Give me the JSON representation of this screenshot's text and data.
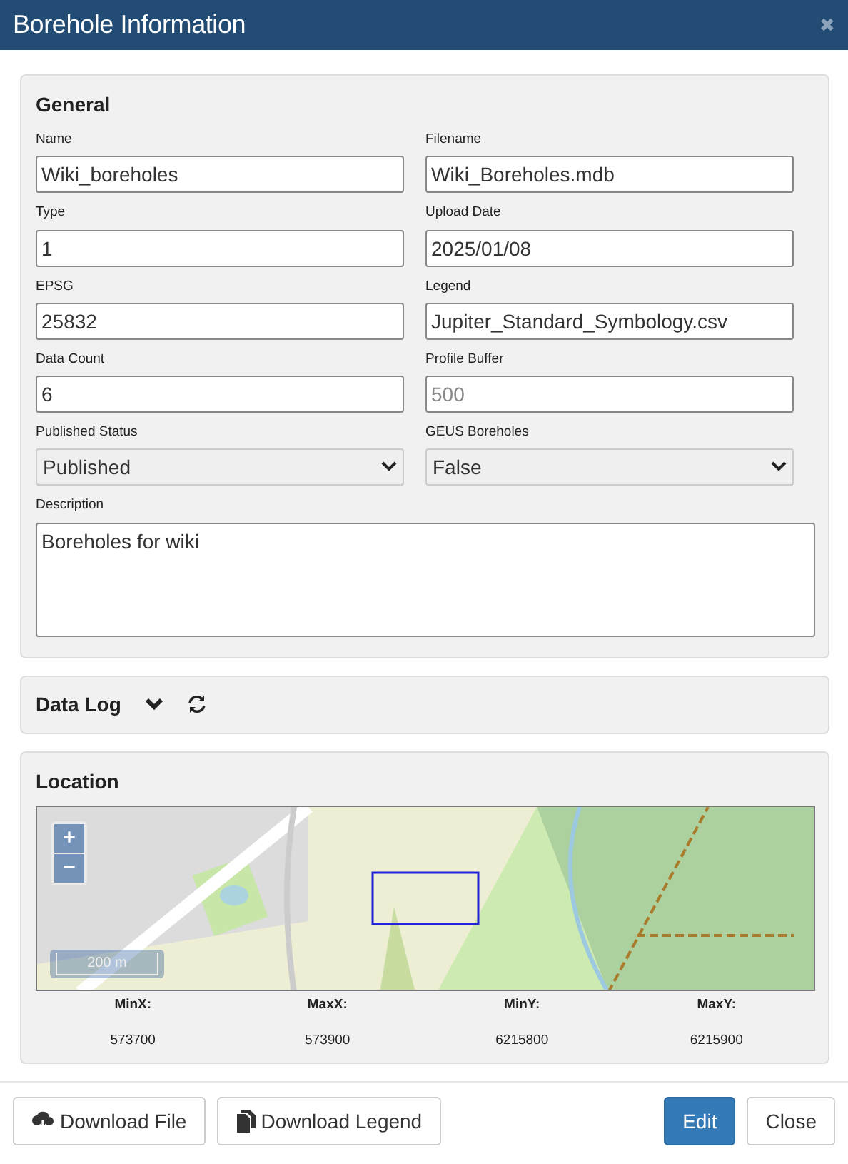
{
  "window": {
    "title": "Borehole Information",
    "close": "✖"
  },
  "general": {
    "title": "General",
    "fields": [
      {
        "label": "Name",
        "kind": "input",
        "value": "Wiki_boreholes"
      },
      {
        "label": "Filename",
        "kind": "input",
        "value": "Wiki_Boreholes.mdb"
      },
      {
        "label": "Type",
        "kind": "input",
        "value": "1"
      },
      {
        "label": "Upload Date",
        "kind": "input",
        "value": "2025/01/08"
      },
      {
        "label": "EPSG",
        "kind": "input",
        "value": "25832"
      },
      {
        "label": "Legend",
        "kind": "input",
        "value": "Jupiter_Standard_Symbology.csv"
      },
      {
        "label": "Data Count",
        "kind": "input",
        "value": "6"
      },
      {
        "label": "Profile Buffer",
        "kind": "input",
        "placeholder": "500"
      },
      {
        "label": "Published Status",
        "kind": "select",
        "value": "Published",
        "disabled": true
      },
      {
        "label": "GEUS Boreholes",
        "kind": "select",
        "value": "False",
        "disabled": true
      },
      {
        "label": "Description",
        "kind": "textarea",
        "value": "Boreholes for wiki"
      }
    ]
  },
  "data_log": {
    "title": "Data Log",
    "expanded": false
  },
  "location": {
    "title": "Location",
    "map": {
      "zoom_in": "+",
      "zoom_out": "−",
      "scale": "200 m"
    },
    "extent": [
      {
        "label": "MinX:",
        "value": "573700"
      },
      {
        "label": "MaxX:",
        "value": "573900"
      },
      {
        "label": "MinY:",
        "value": "6215800"
      },
      {
        "label": "MaxY:",
        "value": "6215900"
      }
    ]
  },
  "footer": {
    "left": [
      {
        "label": "Download File"
      },
      {
        "label": "Download Legend"
      }
    ],
    "right": [
      {
        "label": "Edit",
        "primary": true
      },
      {
        "label": "Close",
        "primary": false
      }
    ]
  }
}
